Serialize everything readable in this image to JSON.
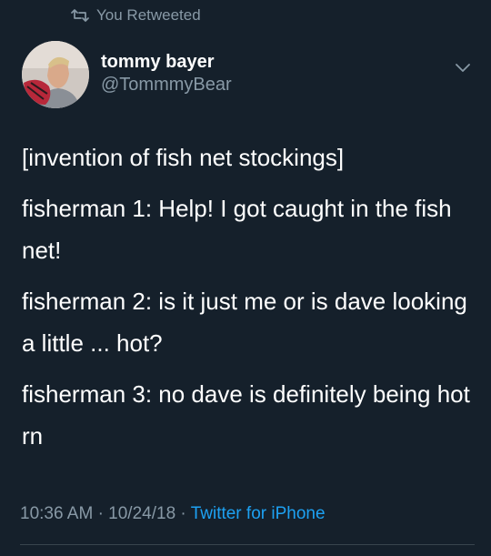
{
  "retweet": {
    "label": "You Retweeted",
    "icon": "retweet-icon"
  },
  "author": {
    "name": "tommy bayer",
    "handle": "@TommmyBear",
    "avatar_icon": "avatar"
  },
  "menu": {
    "icon": "chevron-down-icon"
  },
  "tweet": {
    "paragraphs": [
      "[invention of fish net stockings]",
      "fisherman 1: Help! I got caught in the fish net!",
      "fisherman 2:  is it just me or is dave looking a little ... hot?",
      "fisherman 3: no dave is definitely being hot rn"
    ]
  },
  "meta": {
    "time": "10:36 AM",
    "date": "10/24/18",
    "separator": "·",
    "source": "Twitter for iPhone"
  },
  "colors": {
    "background": "#15202b",
    "text": "#ffffff",
    "muted": "#8899a6",
    "link": "#1da1f2",
    "divider": "#38444d"
  }
}
